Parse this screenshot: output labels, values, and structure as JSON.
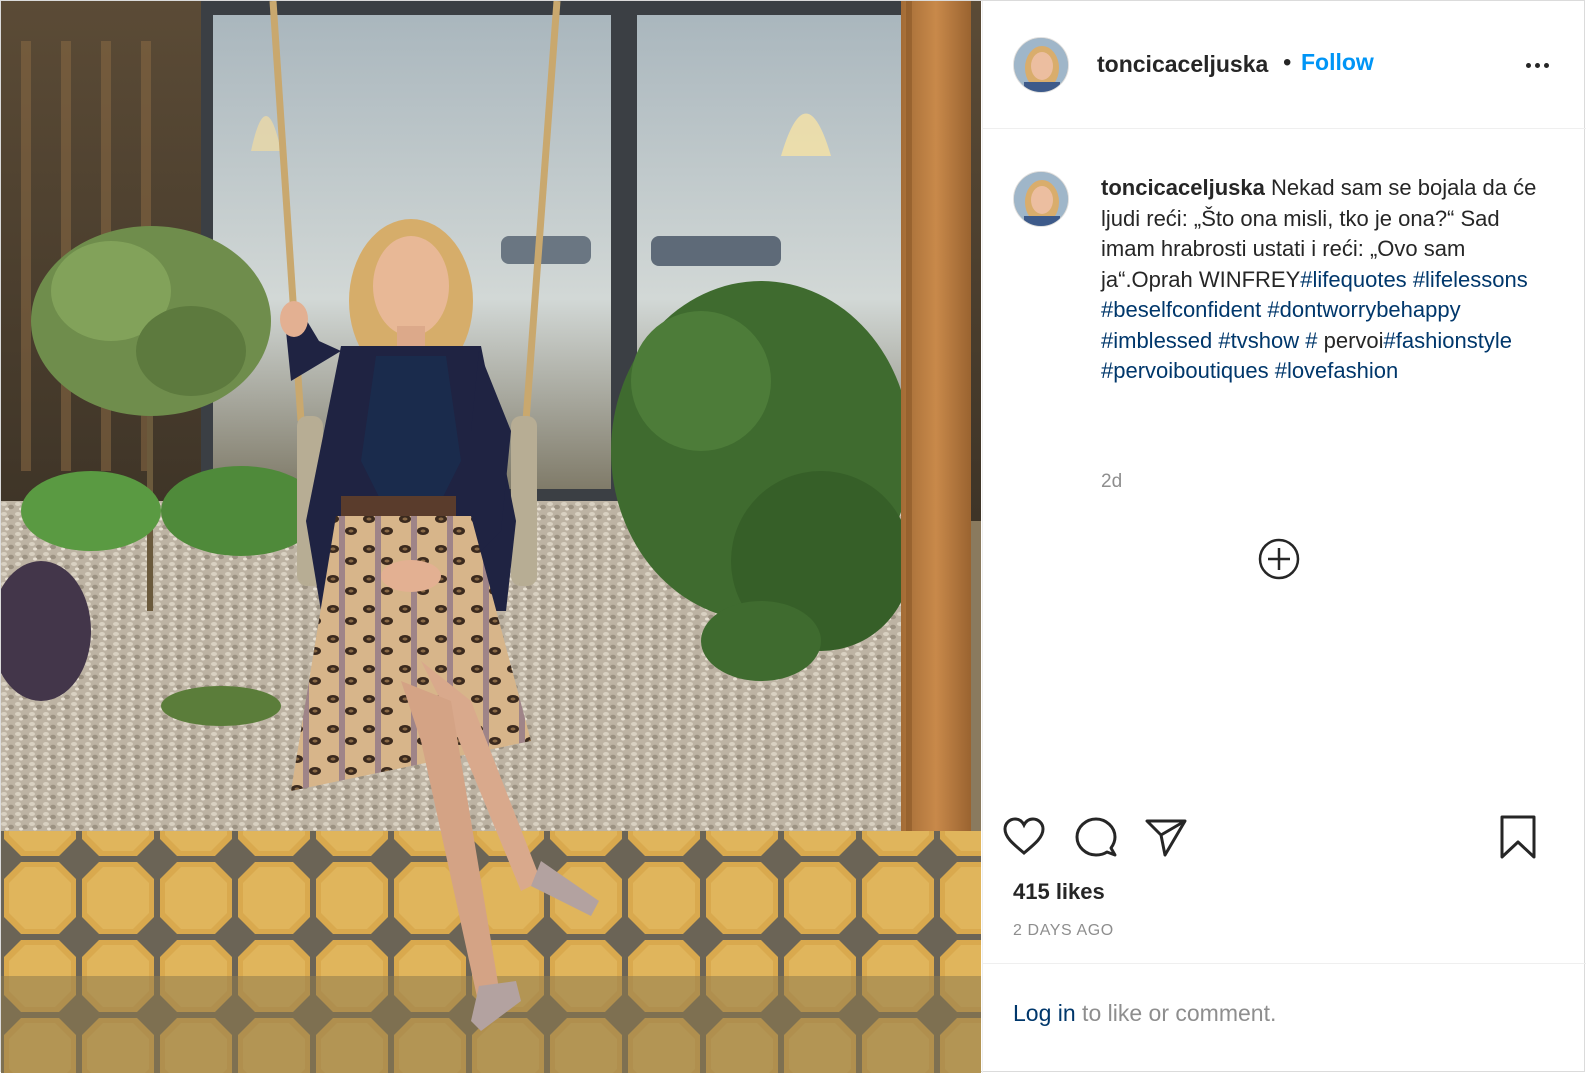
{
  "post": {
    "username": "toncicaceljuska",
    "separator": "•",
    "follow_label": "Follow",
    "more_icon": "more-options-icon"
  },
  "caption": {
    "username": "toncicaceljuska",
    "text": "Nekad sam se bojala da će ljudi reći: „Što ona misli, tko je ona?“ Sad imam hrabrosti ustati i reći: „Ovo sam ja“.Oprah WINFREY",
    "hashtags": [
      "#lifequotes",
      "#lifelessons",
      "#beselfconfident",
      "#dontworrybehappy",
      "#imblessed",
      "#tvshow",
      "#",
      "pervoi",
      "#fashionstyle",
      "#pervoiboutiques",
      "#lovefashion"
    ],
    "age": "2d"
  },
  "actions": {
    "like_icon": "heart-icon",
    "comment_icon": "comment-icon",
    "share_icon": "paper-plane-icon",
    "save_icon": "bookmark-icon",
    "load_more_icon": "plus-circle-icon"
  },
  "stats": {
    "likes": "415 likes",
    "timestamp": "2 DAYS AGO"
  },
  "footer": {
    "login_link": "Log in",
    "login_rest": " to like or comment."
  },
  "colors": {
    "link_blue": "#0095f6",
    "hashtag": "#00376b",
    "text": "#262626",
    "muted": "#8e8e8e"
  }
}
